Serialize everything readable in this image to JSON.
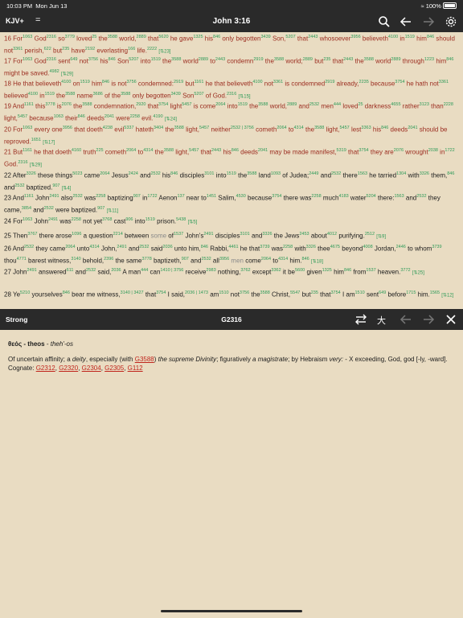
{
  "status": {
    "time": "10:03 PM",
    "date": "Mon Jun 13",
    "battery": "100%"
  },
  "toolbar": {
    "version": "KJV+",
    "menu": "=",
    "title": "John 3:16",
    "icons": [
      "search-icon",
      "back-arrow-icon",
      "forward-arrow-icon"
    ]
  },
  "verses": [
    {
      "color": "red",
      "html": "16 For<sup>1063</sup> God<sup>2316</sup> so<sup>3779</sup> loved<sup>25</sup> the<sup>3588</sup> world,<sup>2889</sup> that<sup>5620</sup> he gave<sup>1325</sup> his<sup>846</sup> only begotten<sup>3439</sup> Son,<sup>5207</sup> that<sup>2443</sup> whosoever<sup>3956</sup> believeth<sup>4100</sup> in<sup>1519</sup> him<sup>846</sup> should not<sup>3361</sup> perish,<sup>622</sup> but<sup>235</sup> have<sup>2192</sup> everlasting<sup>166</sup> life.<sup>2222</sup> <span class=\"ref\">[&#8645;23]</span>"
    },
    {
      "color": "red",
      "html": "17 For<sup>1063</sup> God<sup>2316</sup> sent<sup>649</sup> not<sup>3756</sup> his<sup>846</sup> Son<sup>5207</sup> into<sup>1519</sup> the<sup>3588</sup> world<sup>2889</sup> to<sup>2443</sup> condemn<sup>2919</sup> the<sup>3588</sup> world;<sup>2889</sup> but<sup>235</sup> that<sup>2443</sup> the<sup>3588</sup> world<sup>2889</sup> through<sup>1223</sup> him<sup>846</sup> might be saved.<sup>4982</sup> <span class=\"ref\">[&#8645;29]</span>"
    },
    {
      "color": "red",
      "html": "18 He that believeth<sup>4100</sup> on<sup>1519</sup> him<sup>846</sup> is not<sup>3756</sup> condemned:<sup>2919</sup> but<sup>1161</sup> he that believeth<sup>4100</sup> not<sup>3361</sup> is condemned<sup>2919</sup> already,<sup>2235</sup> because<sup>3754</sup> he hath not<sup>3361</sup> believed<sup>4100</sup> in<sup>1519</sup> the<sup>3588</sup> name<sup>3686</sup> of the<sup>3588</sup> only begotten<sup>3439</sup> Son<sup>5207</sup> of God.<sup>2316</sup> <span class=\"ref\">[&#8645;15]</span>"
    },
    {
      "color": "red",
      "html": "19 And<sup>1161</sup> this<sup>3778</sup> is<sup>2076</sup> the<sup>3588</sup> condemnation,<sup>2920</sup> that<sup>3754</sup> light<sup>5457</sup> is come<sup>2064</sup> into<sup>1519</sup> the<sup>3588</sup> world,<sup>2889</sup> and<sup>2532</sup> men<sup>444</sup> loved<sup>25</sup> darkness<sup>4655</sup> rather<sup>3123</sup> than<sup>2228</sup> light,<sup>5457</sup> because<sup>1063</sup> their<sup>846</sup> deeds<sup>2041</sup> were<sup>2258</sup> evil.<sup>4190</sup> <span class=\"ref\">[&#8645;24]</span>"
    },
    {
      "color": "red",
      "html": "20 For<sup>1063</sup> every one<sup>3956</sup> that doeth<sup>4238</sup> evil<sup>5337</sup> hateth<sup>3404</sup> the<sup>3588</sup> light,<sup>5457</sup> neither<sup>2532 | 3756</sup> cometh<sup>2064</sup> to<sup>4314</sup> the<sup>3588</sup> light,<sup>5457</sup> lest<sup>3363</sup> his<sup>846</sup> deeds<sup>2041</sup> should be reproved.<sup>1651</sup> <span class=\"ref\">[&#8645;17]</span>"
    },
    {
      "color": "red",
      "html": "21 But<sup>1161</sup> he that doeth<sup>4160</sup> truth<sup>225</sup> cometh<sup>2064</sup> to<sup>4314</sup> the<sup>3588</sup> light,<sup>5457</sup> that<sup>2443</sup> his<sup>846</sup> deeds<sup>2041</sup> may be made manifest,<sup>5319</sup> that<sup>3754</sup> they are<sup>2076</sup> wrought<sup>2038</sup> in<sup>1722</sup> God.<sup>2316</sup> <span class=\"ref\">[&#8645;29]</span>"
    },
    {
      "color": "black",
      "html": "22 After<sup>3326</sup> these things<sup>5023</sup> came<sup>2064</sup> Jesus<sup>2424</sup> and<sup>2532</sup> his<sup>846</sup> disciples<sup>3101</sup> into<sup>1519</sup> the<sup>3588</sup> land<sup>1093</sup> of Judea;<sup>2449</sup> and<sup>2532</sup> there<sup>1563</sup> he tarried<sup>1304</sup> with<sup>3326</sup> them,<sup>846</sup> and<sup>2532</sup> baptized.<sup>907</sup> <span class=\"ref\">[&#8645;4]</span>"
    },
    {
      "color": "black",
      "html": "23 And<sup>1161</sup> John<sup>2491</sup> also<sup>2532</sup> was<sup>2258</sup> baptizing<sup>907</sup> in<sup>1722</sup> Aenon<sup>137</sup> near to<sup>1451</sup> Salim,<sup>4530</sup> because<sup>3754</sup> there was<sup>2258</sup> much<sup>4183</sup> water<sup>5204</sup> there:<sup>1563</sup> and<sup>2532</sup> they came,<sup>3854</sup> and<sup>2532</sup> were baptized.<sup>907</sup> <span class=\"ref\">[&#8645;11]</span>"
    },
    {
      "color": "black",
      "html": "24 For<sup>1063</sup> John<sup>2491</sup> was<sup>2258</sup> not yet<sup>3768</sup> cast<sup>906</sup> into<sup>1519</sup> prison.<sup>5438</sup> <span class=\"ref\">[&#8645;5]</span>"
    },
    {
      "color": "black",
      "html": "25 Then<sup>3767</sup> there arose<sup>1096</sup> a question<sup>2214</sup> between <span style=\"color:#8a8a8a\">some</span> of<sup>1537</sup> John's<sup>2491</sup> disciples<sup>3101</sup> and<sup>3326</sup> the Jews<sup>2453</sup> about<sup>4012</sup> purifying.<sup>2512</sup> <span class=\"ref\">[&#8645;9]</span>"
    },
    {
      "color": "black",
      "html": "26 And<sup>2532</sup> they came<sup>2064</sup> unto<sup>4314</sup> John,<sup>2491</sup> and<sup>2532</sup> said<sup>2036</sup> unto him,<sup>846</sup> Rabbi,<sup>4461</sup> he that<sup>3739</sup> was<sup>2258</sup> with<sup>3326</sup> thee<sup>4675</sup> beyond<sup>4008</sup> Jordan,<sup>2446</sup> to whom<sup>3739</sup> thou<sup>4771</sup> barest witness,<sup>3140</sup> behold,<sup>2396</sup> the same<sup>3778</sup> baptizeth,<sup>907</sup> and<sup>2532</sup> all<sup>3956</sup> <span style=\"color:#8a8a8a\">men</span> come<sup>2064</sup> to<sup>4314</sup> him.<sup>846</sup> <span class=\"ref\">[&#8645;18]</span>"
    },
    {
      "color": "black",
      "html": "27 John<sup>2491</sup> answered<sup>611</sup> and<sup>2532</sup> said,<sup>2036</sup> A man<sup>444</sup> can<sup>1410 | 3756</sup> receive<sup>2983</sup> nothing,<sup>3762</sup> except<sup>3362</sup> it be<sup>5600</sup> given<sup>1325</sup> him<sup>846</sup> from<sup>1537</sup> heaven.<sup>3772</sup> <span class=\"ref\">[&#8645;25]</span>"
    },
    {
      "color": "black",
      "html": "28 Ye<sup>5210</sup> yourselves<sup>846</sup> bear me witness,<sup>3140 | 3427</sup> that<sup>3754</sup> I said,<sup>2036 | 1473</sup> am<sup>1510</sup> not<sup>3756</sup> the<sup>3588</sup> Christ,<sup>5547</sup> but<sup>235</sup> that<sup>3754</sup> I am<sup>1510</sup> sent<sup>649</sup> before<sup>1715</sup> him.<sup>1565</sup> <span class=\"ref\">[&#8645;12]</span>"
    }
  ],
  "strong_bar": {
    "label": "Strong",
    "code": "G2316",
    "icons": [
      "swap-icon",
      "translate-icon",
      "back-arrow-icon",
      "forward-arrow-icon",
      "close-icon"
    ]
  },
  "strong": {
    "word": "θεός - theos",
    "pron": "theh'-os",
    "def_a": "Of uncertain affinity; a ",
    "def_b": "deity",
    "def_c": ", especially (with ",
    "def_link": "G3588",
    "def_d": ") ",
    "def_e": "the supreme Divinity",
    "def_f": "; figuratively ",
    "def_g": "a magistrate",
    "def_h": "; by Hebraism ",
    "def_i": "very:",
    "def_j": " - X exceeding, God, god [-ly, -ward].",
    "cognate_label": "Cognate: ",
    "cognates": [
      "G2312",
      "G2320",
      "G2304",
      "G2305",
      "G112"
    ]
  },
  "colors": {
    "bar": "#2a2a2a",
    "paper": "#e9dcc2",
    "red_letter": "#9b2d20",
    "strong_number": "#2b9a57",
    "link": "#c0261d"
  }
}
